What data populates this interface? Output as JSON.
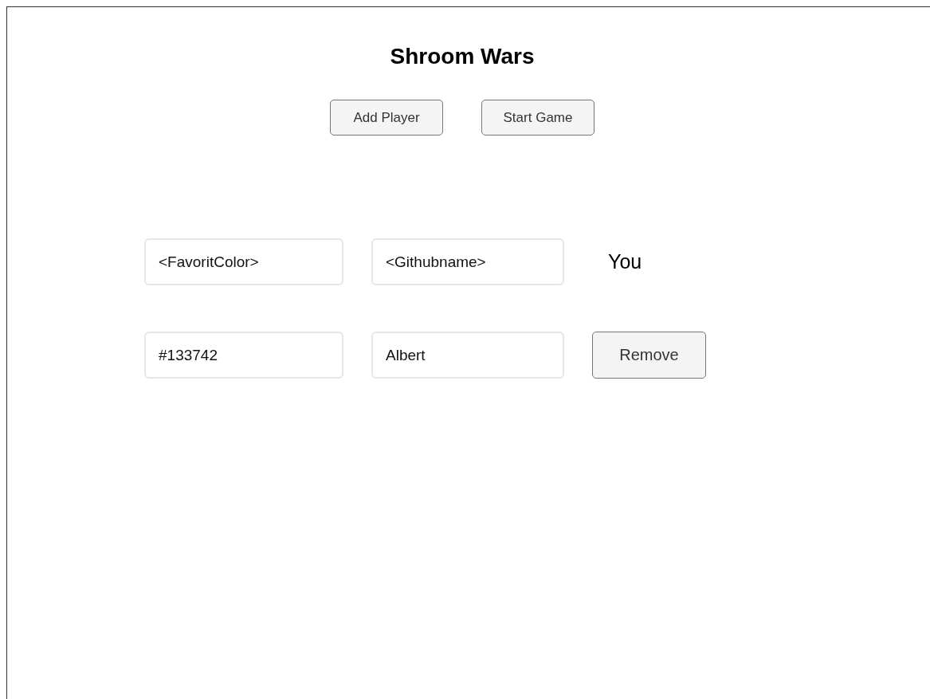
{
  "title": "Shroom Wars",
  "buttons": [
    "Add Player",
    "Start Game"
  ],
  "players": [
    {
      "kind": "self",
      "color_text": "<FavoritColor>",
      "name": "<Githubname>",
      "label": "You"
    },
    {
      "kind": "other",
      "color_text": "#133742",
      "name": "Albert",
      "action": "Remove"
    }
  ]
}
